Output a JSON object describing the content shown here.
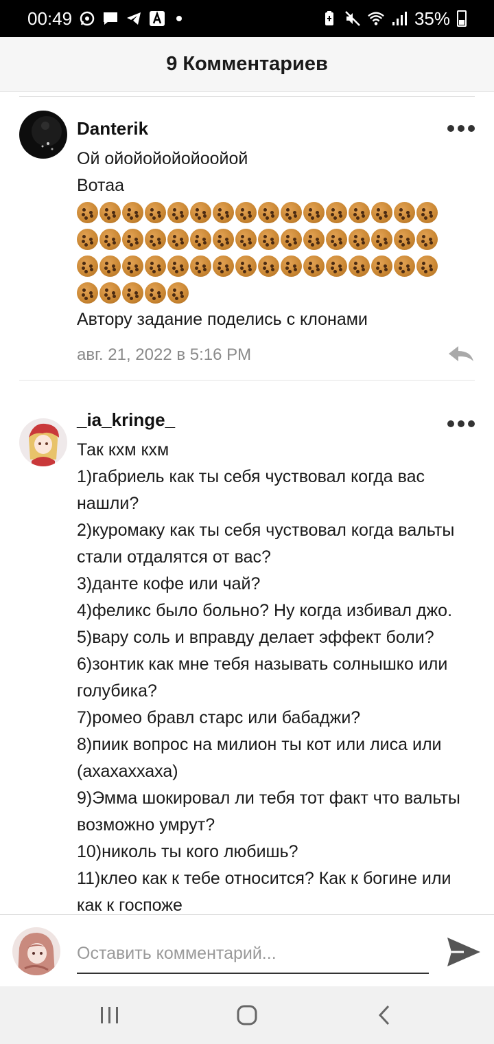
{
  "status": {
    "time": "00:49",
    "battery": "35%"
  },
  "header": {
    "title": "9 Комментариев"
  },
  "comments": [
    {
      "username": "Danterik",
      "lines_before": [
        "Ой ойойойойойоойой",
        "Вотаа"
      ],
      "cookie_rows": [
        16,
        16,
        16,
        5
      ],
      "lines_after": [
        "Автору задание поделись с клонами"
      ],
      "timestamp": "авг. 21, 2022 в 5:16 PM"
    },
    {
      "username": "_ia_kringe_",
      "lines": [
        "Так кхм кхм",
        "1)габриель как ты себя чуствовал когда вас",
        "нашли?",
        "2)куромаку как ты себя чуствовал когда вальты",
        "стали отдалятся от вас?",
        "3)данте кофе или чай?",
        "4)феликс было больно? Ну когда избивал джо.",
        "5)вару соль и вправду делает эффект боли?",
        "6)зонтик как мне тебя называть солнышко или",
        "голубика?",
        "7)ромео бравл старс или бабаджи?",
        "8)пиик вопрос на милион ты кот или лиса или",
        "(ахахаххаха)",
        "9)Эмма шокировал ли тебя тот факт что вальты",
        "возможно умрут?",
        "10)николь ты кого любишь?",
        "11)клео как к тебе относится? Как к богине или",
        "как к госпоже"
      ]
    }
  ],
  "composer": {
    "placeholder": "Оставить комментарий..."
  },
  "icons": {
    "more": "more-dots-icon",
    "reply": "reply-arrow-icon",
    "send": "send-icon",
    "nav": [
      "recents-icon",
      "home-icon",
      "back-icon"
    ]
  }
}
